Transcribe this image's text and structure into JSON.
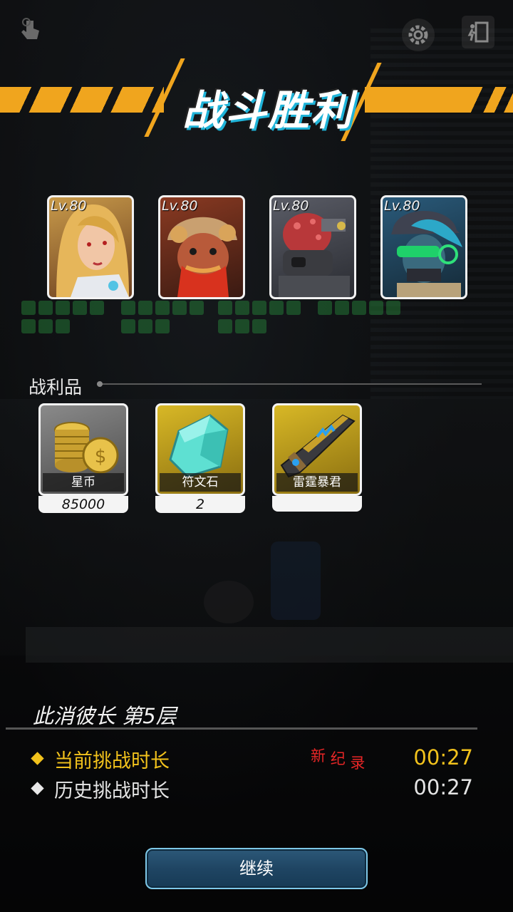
{
  "banner": {
    "title": "战斗胜利"
  },
  "top_bar": {
    "left_icon": "hand-touch-icon",
    "settings_icon": "gear-icon",
    "exit_icon": "exit-door-icon"
  },
  "heroes": [
    {
      "level": "Lv.80",
      "portrait": "blonde-woman-portrait"
    },
    {
      "level": "Lv.80",
      "portrait": "bearded-man-helmet-portrait"
    },
    {
      "level": "Lv.80",
      "portrait": "mutant-gasmask-portrait"
    },
    {
      "level": "Lv.80",
      "portrait": "goggles-cap-portrait"
    }
  ],
  "loot": {
    "label": "战利品",
    "items": [
      {
        "name": "星币",
        "qty": "85000",
        "icon": "coin-stack-icon",
        "frame": "gray"
      },
      {
        "name": "符文石",
        "qty": "2",
        "icon": "rune-crystal-icon",
        "frame": "gold"
      },
      {
        "name": "雷霆暴君",
        "qty": "",
        "icon": "thunder-rifle-icon",
        "frame": "gold"
      }
    ]
  },
  "stage": {
    "title": "此消彼长 第5层",
    "current_label": "当前挑战时长",
    "current_time": "00:27",
    "new_record": [
      "新",
      "纪",
      "录"
    ],
    "history_label": "历史挑战时长",
    "history_time": "00:27"
  },
  "continue_button": {
    "label": "继续"
  },
  "colors": {
    "accent": "#f0a51e",
    "current_row": "#f2c21c",
    "new_record": "#e82626",
    "button_border": "#7ec8e8"
  }
}
